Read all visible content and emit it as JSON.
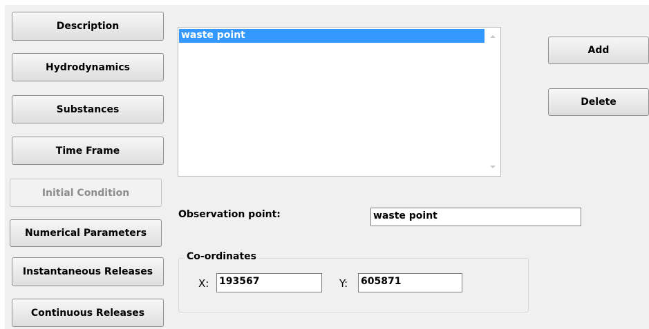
{
  "nav_buttons": [
    {
      "label": "Description",
      "enabled": true
    },
    {
      "label": "Hydrodynamics",
      "enabled": true
    },
    {
      "label": "Substances",
      "enabled": true
    },
    {
      "label": "Time Frame",
      "enabled": true
    },
    {
      "label": "Initial Condition",
      "enabled": false
    },
    {
      "label": "Numerical Parameters",
      "enabled": true
    },
    {
      "label": "Instantaneous Releases",
      "enabled": true
    },
    {
      "label": "Continuous Releases",
      "enabled": true
    }
  ],
  "observation_list": {
    "items": [
      "waste point"
    ],
    "selected_index": 0
  },
  "actions": {
    "add_label": "Add",
    "delete_label": "Delete"
  },
  "observation_point": {
    "label": "Observation point:",
    "value": "waste point"
  },
  "coordinates": {
    "title": "Co-ordinates",
    "x_label": "X:",
    "x_value": "193567",
    "y_label": "Y:",
    "y_value": "605871"
  },
  "colors": {
    "panel_background": "#f0f0f0",
    "selection": "#3399ff",
    "disabled_text": "#8d8d8d"
  }
}
